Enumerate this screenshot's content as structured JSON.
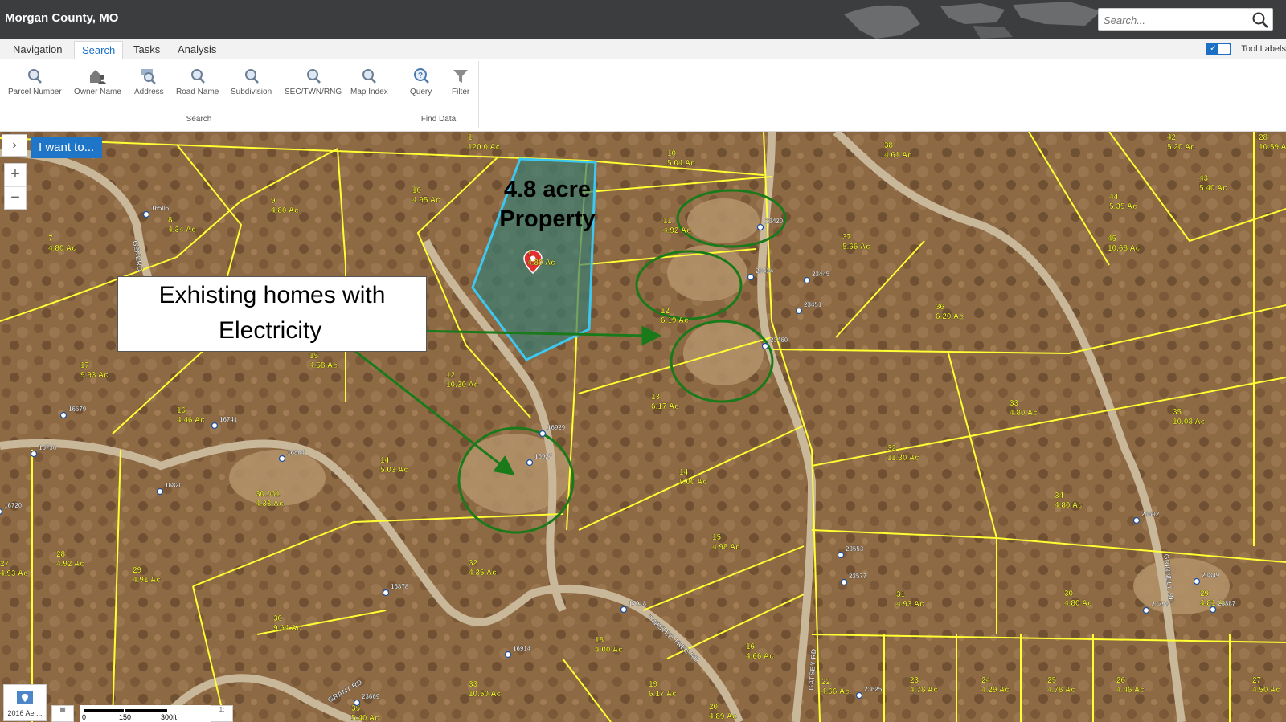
{
  "header": {
    "title": "Morgan County, MO",
    "search_placeholder": "Search..."
  },
  "tabs": [
    {
      "label": "Navigation",
      "active": false
    },
    {
      "label": "Search",
      "active": true
    },
    {
      "label": "Tasks",
      "active": false
    },
    {
      "label": "Analysis",
      "active": false
    }
  ],
  "tool_labels": {
    "label": "Tool Labels",
    "checked": true
  },
  "ribbon": {
    "search_group": "Search",
    "find_group": "Find Data",
    "tools": [
      {
        "label": "Parcel Number",
        "icon": "magnifier-icon"
      },
      {
        "label": "Owner Name",
        "icon": "house-person-icon"
      },
      {
        "label": "Address",
        "icon": "address-magnifier-icon"
      },
      {
        "label": "Road Name",
        "icon": "magnifier-icon"
      },
      {
        "label": "Subdivision",
        "icon": "magnifier-icon"
      },
      {
        "label": "SEC/TWN/RNG",
        "icon": "magnifier-icon"
      },
      {
        "label": "Map Index",
        "icon": "magnifier-icon"
      },
      {
        "label": "Query",
        "icon": "query-magnifier-icon"
      },
      {
        "label": "Filter",
        "icon": "funnel-icon"
      }
    ]
  },
  "map": {
    "i_want_to": "I want to...",
    "zoom_in": "+",
    "zoom_out": "−",
    "panel_toggle": "›",
    "property_title_line1": "4.8 acre",
    "property_title_line2": "Property",
    "callout_line1": "Exhisting homes with",
    "callout_line2": "Electricity",
    "basemap_label": "2016 Aer...",
    "scale": {
      "t0": "0",
      "t1": "150",
      "t2": "300ft"
    },
    "parcel_color": "#ffff33",
    "highlight_color": "#3cc8f0",
    "circle_color": "#1a7a1a",
    "parcels": [
      {
        "n": "1",
        "a": "120.0 Ac"
      },
      {
        "n": "10",
        "a": "5.04 Ac"
      },
      {
        "n": "38",
        "a": "4.61 Ac"
      },
      {
        "n": "42",
        "a": "5.20 Ac"
      },
      {
        "n": "10",
        "a": "4.95 Ac"
      },
      {
        "n": "9",
        "a": "4.80 Ac"
      },
      {
        "n": "8",
        "a": "4.34 Ac"
      },
      {
        "n": "7",
        "a": "4.80 Ac"
      },
      {
        "n": "43",
        "a": "5.40 Ac"
      },
      {
        "n": "44",
        "a": "5.35 Ac"
      },
      {
        "n": "11",
        "a": "4.92 Ac"
      },
      {
        "n": "37",
        "a": "5.66 Ac"
      },
      {
        "n": "45",
        "a": "10.68 Ac"
      },
      {
        "n": "1",
        "a": "4.80 Ac"
      },
      {
        "n": "12",
        "a": "6.19 Ac"
      },
      {
        "n": "36",
        "a": "6.20 Ac"
      },
      {
        "n": "15",
        "a": "4.58 Ac"
      },
      {
        "n": "17",
        "a": "9.93 Ac"
      },
      {
        "n": "12",
        "a": "10.30 Ac"
      },
      {
        "n": "13",
        "a": "6.17 Ac"
      },
      {
        "n": "33",
        "a": "4.80 Ac"
      },
      {
        "n": "35",
        "a": "10.08 Ac"
      },
      {
        "n": "16",
        "a": "4.46 Ac"
      },
      {
        "n": "14",
        "a": "5.03 Ac"
      },
      {
        "n": "14",
        "a": "5.00 Ac"
      },
      {
        "n": "32",
        "a": "11.30 Ac"
      },
      {
        "n": "30.001",
        "a": "4.33 Ac"
      },
      {
        "n": "34",
        "a": "4.80 Ac"
      },
      {
        "n": "15",
        "a": "4.98 Ac"
      },
      {
        "n": "28",
        "a": "4.92 Ac"
      },
      {
        "n": "27",
        "a": "4.93 Ac"
      },
      {
        "n": "29",
        "a": "4.91 Ac"
      },
      {
        "n": "32",
        "a": "4.35 Ac"
      },
      {
        "n": "31",
        "a": "4.93 Ac"
      },
      {
        "n": "30",
        "a": "4.80 Ac"
      },
      {
        "n": "29",
        "a": "4.81 Ac"
      },
      {
        "n": "30",
        "a": "9.64 Ac"
      },
      {
        "n": "18",
        "a": "4.00 Ac"
      },
      {
        "n": "16",
        "a": "4.66 Ac"
      },
      {
        "n": "33",
        "a": "10.50 Ac"
      },
      {
        "n": "19",
        "a": "6.17 Ac"
      },
      {
        "n": "22",
        "a": "4.66 Ac"
      },
      {
        "n": "23",
        "a": "4.78 Ac"
      },
      {
        "n": "24",
        "a": "4.29 Ac"
      },
      {
        "n": "25",
        "a": "4.78 Ac"
      },
      {
        "n": "26",
        "a": "4.46 Ac"
      },
      {
        "n": "27",
        "a": "4.50 Ac"
      },
      {
        "n": "28",
        "a": "10.59 Ac"
      },
      {
        "n": "20",
        "a": "4.89 Ac"
      },
      {
        "n": "35",
        "a": "5.40 Ac"
      }
    ],
    "addresses": [
      "16505",
      "23420",
      "23434",
      "23445",
      "23451",
      "23460",
      "16679",
      "16741",
      "16736",
      "16804",
      "16820",
      "16720",
      "16929",
      "16927",
      "23692",
      "23553",
      "23577",
      "16878",
      "17018",
      "23849",
      "23887",
      "23758",
      "16914",
      "23669",
      "23625"
    ],
    "roads": [
      "TWISTED TREE RD",
      "GATSBY RD",
      "GRANT RD",
      "GRINNELL RD",
      "GENERO"
    ]
  }
}
